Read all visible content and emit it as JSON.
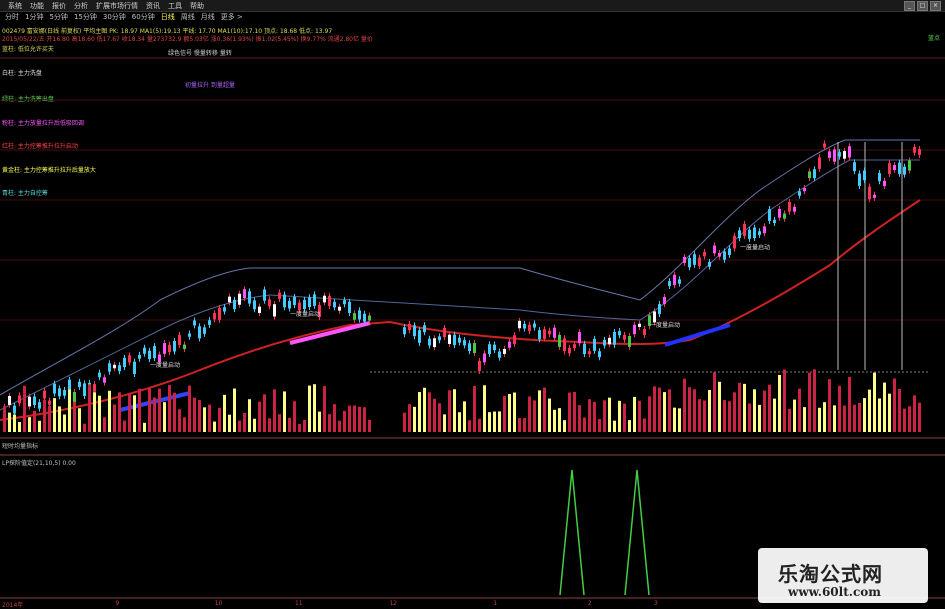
{
  "menu": [
    "系统",
    "功能",
    "报价",
    "分析",
    "扩展市场行情",
    "资讯",
    "工具",
    "帮助"
  ],
  "window_buttons": [
    "_",
    "□",
    "×"
  ],
  "periods": [
    {
      "label": "分时",
      "active": false
    },
    {
      "label": "1分钟",
      "active": false
    },
    {
      "label": "5分钟",
      "active": false
    },
    {
      "label": "15分钟",
      "active": false
    },
    {
      "label": "30分钟",
      "active": false
    },
    {
      "label": "60分钟",
      "active": false
    },
    {
      "label": "日线",
      "active": true
    },
    {
      "label": "周线",
      "active": false
    },
    {
      "label": "月线",
      "active": false
    },
    {
      "label": "更多 >",
      "active": false
    }
  ],
  "indicator_line1": "002479 富安娜(日线 前复权) 平均主图 PK: 18.97  MA1(5):19.13   平线: 17.70  MA1(10):17.10   顶点: 18.68  低点: 13.97",
  "indicator_line2": "2015/05/22/五 开16.80 高18.60 低17.67 收18.34 量273732.9 额5.03亿 涨0.36(1.93%) 振1.02(5.45%) 换9.77% 流通2.80亿  量价",
  "top_right_label": "蓝点",
  "legend": [
    {
      "text": "蓝柱: 低位允许买夫",
      "color": "#dddd55"
    },
    {
      "text": "白柱: 主力洗盘",
      "color": "#e0e0e0"
    },
    {
      "text": "绿柱: 主力洗筹出盘",
      "color": "#55dd55"
    },
    {
      "text": "粉柱: 主力放量拉升后低吸回调",
      "color": "#ff55ff"
    },
    {
      "text": "红柱: 主力控筹推升拉升启动",
      "color": "#ff4444"
    },
    {
      "text": "黄金柱: 主力控筹推升拉升后量放大",
      "color": "#ffff55"
    },
    {
      "text": "青柱: 主力自控筹",
      "color": "#55dddd"
    }
  ],
  "mid_label1": "绿色信号  慢量转移  量转",
  "mid_label2": "初量拉升 到量超量",
  "annotations": [
    "一度量启动",
    "一度量启动",
    "一度量启动",
    "一度量启动"
  ],
  "volume_panel_label": "短时均量指标",
  "sub_panel_label": "LP探阶值定(21,10,5)  0.00",
  "date_axis": [
    {
      "label": "2014年",
      "pos": 0.0
    },
    {
      "label": "9",
      "pos": 0.12
    },
    {
      "label": "10",
      "pos": 0.225
    },
    {
      "label": "11",
      "pos": 0.31
    },
    {
      "label": "12",
      "pos": 0.41
    },
    {
      "label": "1",
      "pos": 0.52
    },
    {
      "label": "2",
      "pos": 0.62
    },
    {
      "label": "3",
      "pos": 0.69
    }
  ],
  "watermark": {
    "title": "乐淘公式网",
    "url": "www.60lt.com"
  },
  "colors": {
    "up": "#ff3355",
    "down": "#44ccff",
    "ma_red": "#dd2222",
    "ma_blue": "#3344ff",
    "ma_magenta": "#ff55ff",
    "vol_yellow": "#ffff88",
    "vol_red": "#cc2244",
    "signal_green": "#44cc44"
  }
}
